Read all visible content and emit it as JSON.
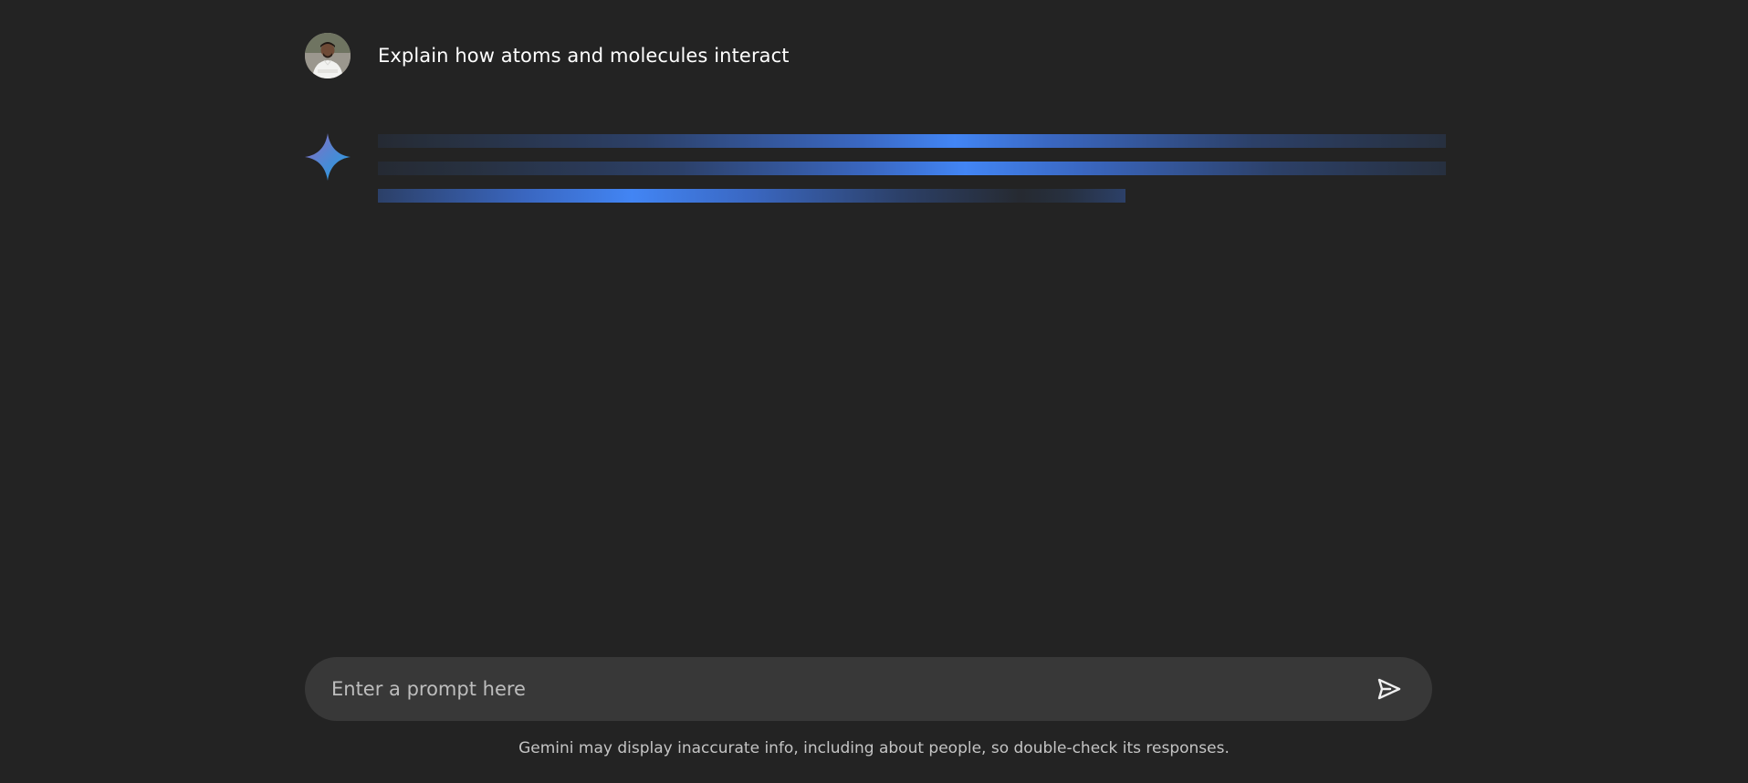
{
  "chat": {
    "user_message": "Explain how atoms and molecules interact",
    "avatar_icon": "user-avatar-photo",
    "assistant_icon": "gemini-sparkle-icon",
    "response_state": "loading"
  },
  "composer": {
    "placeholder": "Enter a prompt here",
    "value": "",
    "send_icon": "send-icon"
  },
  "footer": {
    "disclaimer": "Gemini may display inaccurate info, including about people, so double-check its responses."
  },
  "colors": {
    "background": "#232323",
    "input_background": "#383838",
    "accent_blue": "#4285f4",
    "text_primary": "#ffffff",
    "text_secondary": "#c4c4c4"
  }
}
